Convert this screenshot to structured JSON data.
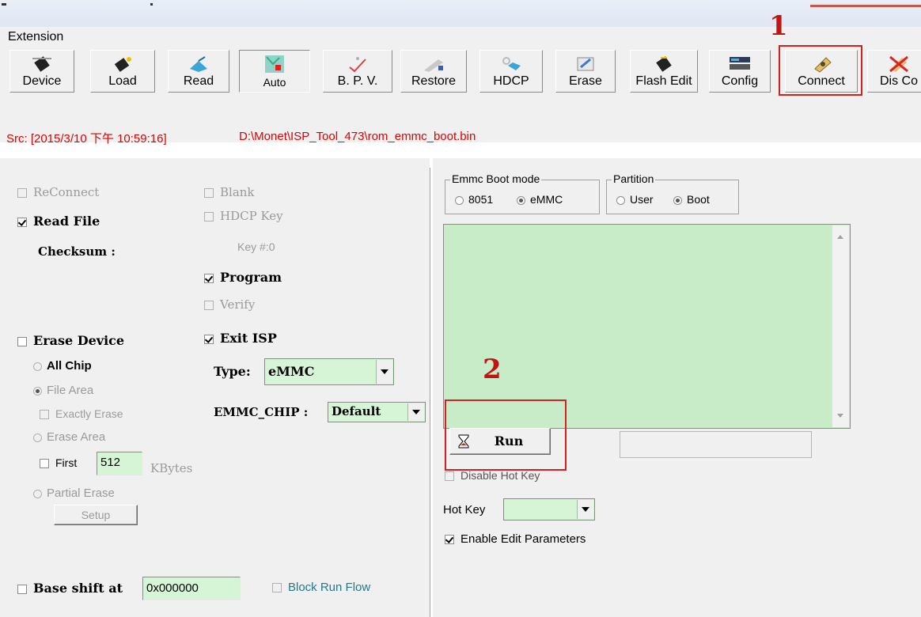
{
  "menu": {
    "extension": "Extension"
  },
  "toolbar": {
    "buttons": [
      {
        "label": "Device",
        "icon": "chip-icon"
      },
      {
        "label": "Load",
        "icon": "chip-load-icon"
      },
      {
        "label": "Read",
        "icon": "read-icon"
      },
      {
        "label": "Auto",
        "icon": "auto-icon"
      },
      {
        "label": "B. P. V.",
        "icon": "check-icon"
      },
      {
        "label": "Restore",
        "icon": "restore-icon"
      },
      {
        "label": "HDCP",
        "icon": "key-icon"
      },
      {
        "label": "Erase",
        "icon": "eraser-icon"
      },
      {
        "label": "Flash Edit",
        "icon": "chip-edit-icon"
      },
      {
        "label": "Config",
        "icon": "config-icon"
      },
      {
        "label": "Connect",
        "icon": "connect-icon"
      },
      {
        "label": "Dis Co",
        "icon": "disconnect-icon"
      }
    ]
  },
  "status": {
    "src": "Src: [2015/3/10 下午 10:59:16]",
    "path": "D:\\Monet\\ISP_Tool_473\\rom_emmc_boot.bin"
  },
  "left": {
    "reconnect": "ReConnect",
    "read_file": "Read File",
    "checksum": "Checksum :",
    "blank": "Blank",
    "hdcp_key": "HDCP Key",
    "key_num": "Key #:0",
    "program": "Program",
    "verify": "Verify",
    "erase_device": "Erase Device",
    "exit_isp": "Exit ISP",
    "all_chip": "All Chip",
    "file_area": "File Area",
    "exactly_erase": "Exactly Erase",
    "erase_area": "Erase Area",
    "first": "First",
    "first_value": "512",
    "kbytes": "KBytes",
    "partial_erase": "Partial Erase",
    "setup": "Setup",
    "type_label": "Type:",
    "type_value": "eMMC",
    "emmc_chip_label": "EMMC_CHIP :",
    "emmc_chip_value": "Default",
    "base_shift": "Base shift at",
    "base_shift_value": "0x000000",
    "block_run_flow": "Block Run Flow"
  },
  "right": {
    "boot_mode_title": "Emmc Boot mode",
    "opt_8051": "8051",
    "opt_emmc": "eMMC",
    "partition_title": "Partition",
    "opt_user": "User",
    "opt_boot": "Boot",
    "run": "Run",
    "disable_hot_key": "Disable Hot Key",
    "hot_key_label": "Hot Key",
    "enable_edit": "Enable Edit Parameters"
  },
  "annotations": {
    "one": "1",
    "two": "2"
  },
  "colors": {
    "status_red": "#e00000",
    "field_green": "#d6f5d6",
    "annotation_red": "#d42020",
    "block_run_teal": "#1f7a8c"
  }
}
